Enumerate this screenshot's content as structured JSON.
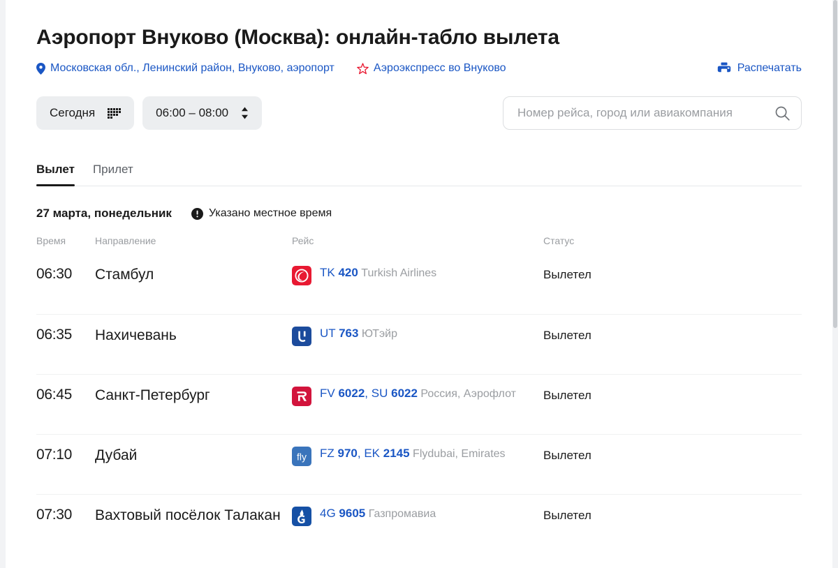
{
  "header": {
    "title": "Аэропорт Внуково (Москва): онлайн-табло вылета",
    "location_link": "Московская обл., Ленинский район, Внуково, аэропорт",
    "location_icon": "map-pin-icon",
    "aeroexpress_link": "Аэроэкспресс во Внуково",
    "aeroexpress_icon": "aeroexpress-star-icon",
    "print_label": "Распечатать",
    "print_icon": "printer-icon",
    "link_color": "#1a56c4"
  },
  "filters": {
    "date_label": "Сегодня",
    "date_icon": "calendar-grid-icon",
    "time_range_label": "06:00 – 08:00",
    "time_range_icon": "stepper-updown-icon",
    "chip_bg": "#eceef0"
  },
  "search": {
    "value": "",
    "placeholder": "Номер рейса, город или авиакомпания",
    "icon": "search-icon"
  },
  "tabs": [
    {
      "label": "Вылет",
      "active": true
    },
    {
      "label": "Прилет",
      "active": false
    }
  ],
  "board_meta": {
    "date": "27 марта, понедельник",
    "note": "Указано местное время",
    "note_icon": "info-exclamation-icon"
  },
  "columns": {
    "time": "Время",
    "destination": "Направление",
    "flight": "Рейс",
    "status": "Статус"
  },
  "flights": [
    {
      "time": "06:30",
      "destination": "Стамбул",
      "numbers": [
        {
          "carrier": "TK",
          "number": "420"
        }
      ],
      "airlines": "Turkish Airlines",
      "status": "Вылетел",
      "logo": "turkish-airlines-logo",
      "logo_color": "#e81932"
    },
    {
      "time": "06:35",
      "destination": "Нахичевань",
      "numbers": [
        {
          "carrier": "UT",
          "number": "763"
        }
      ],
      "airlines": "ЮТэйр",
      "status": "Вылетел",
      "logo": "utair-logo",
      "logo_color": "#1c4b9c"
    },
    {
      "time": "06:45",
      "destination": "Санкт-Петербург",
      "numbers": [
        {
          "carrier": "FV",
          "number": "6022"
        },
        {
          "carrier": "SU",
          "number": "6022"
        }
      ],
      "airlines": "Россия, Аэрофлот",
      "status": "Вылетел",
      "logo": "rossiya-logo",
      "logo_color": "#d2143c"
    },
    {
      "time": "07:10",
      "destination": "Дубай",
      "numbers": [
        {
          "carrier": "FZ",
          "number": "970"
        },
        {
          "carrier": "EK",
          "number": "2145"
        }
      ],
      "airlines": "Flydubai, Emirates",
      "status": "Вылетел",
      "logo": "flydubai-logo",
      "logo_color": "#3a74bb"
    },
    {
      "time": "07:30",
      "destination": "Вахтовый посёлок Талакан",
      "numbers": [
        {
          "carrier": "4G",
          "number": "9605"
        }
      ],
      "airlines": "Газпромавиа",
      "status": "Вылетел",
      "logo": "gazpromavia-logo",
      "logo_color": "#1550a5"
    }
  ]
}
